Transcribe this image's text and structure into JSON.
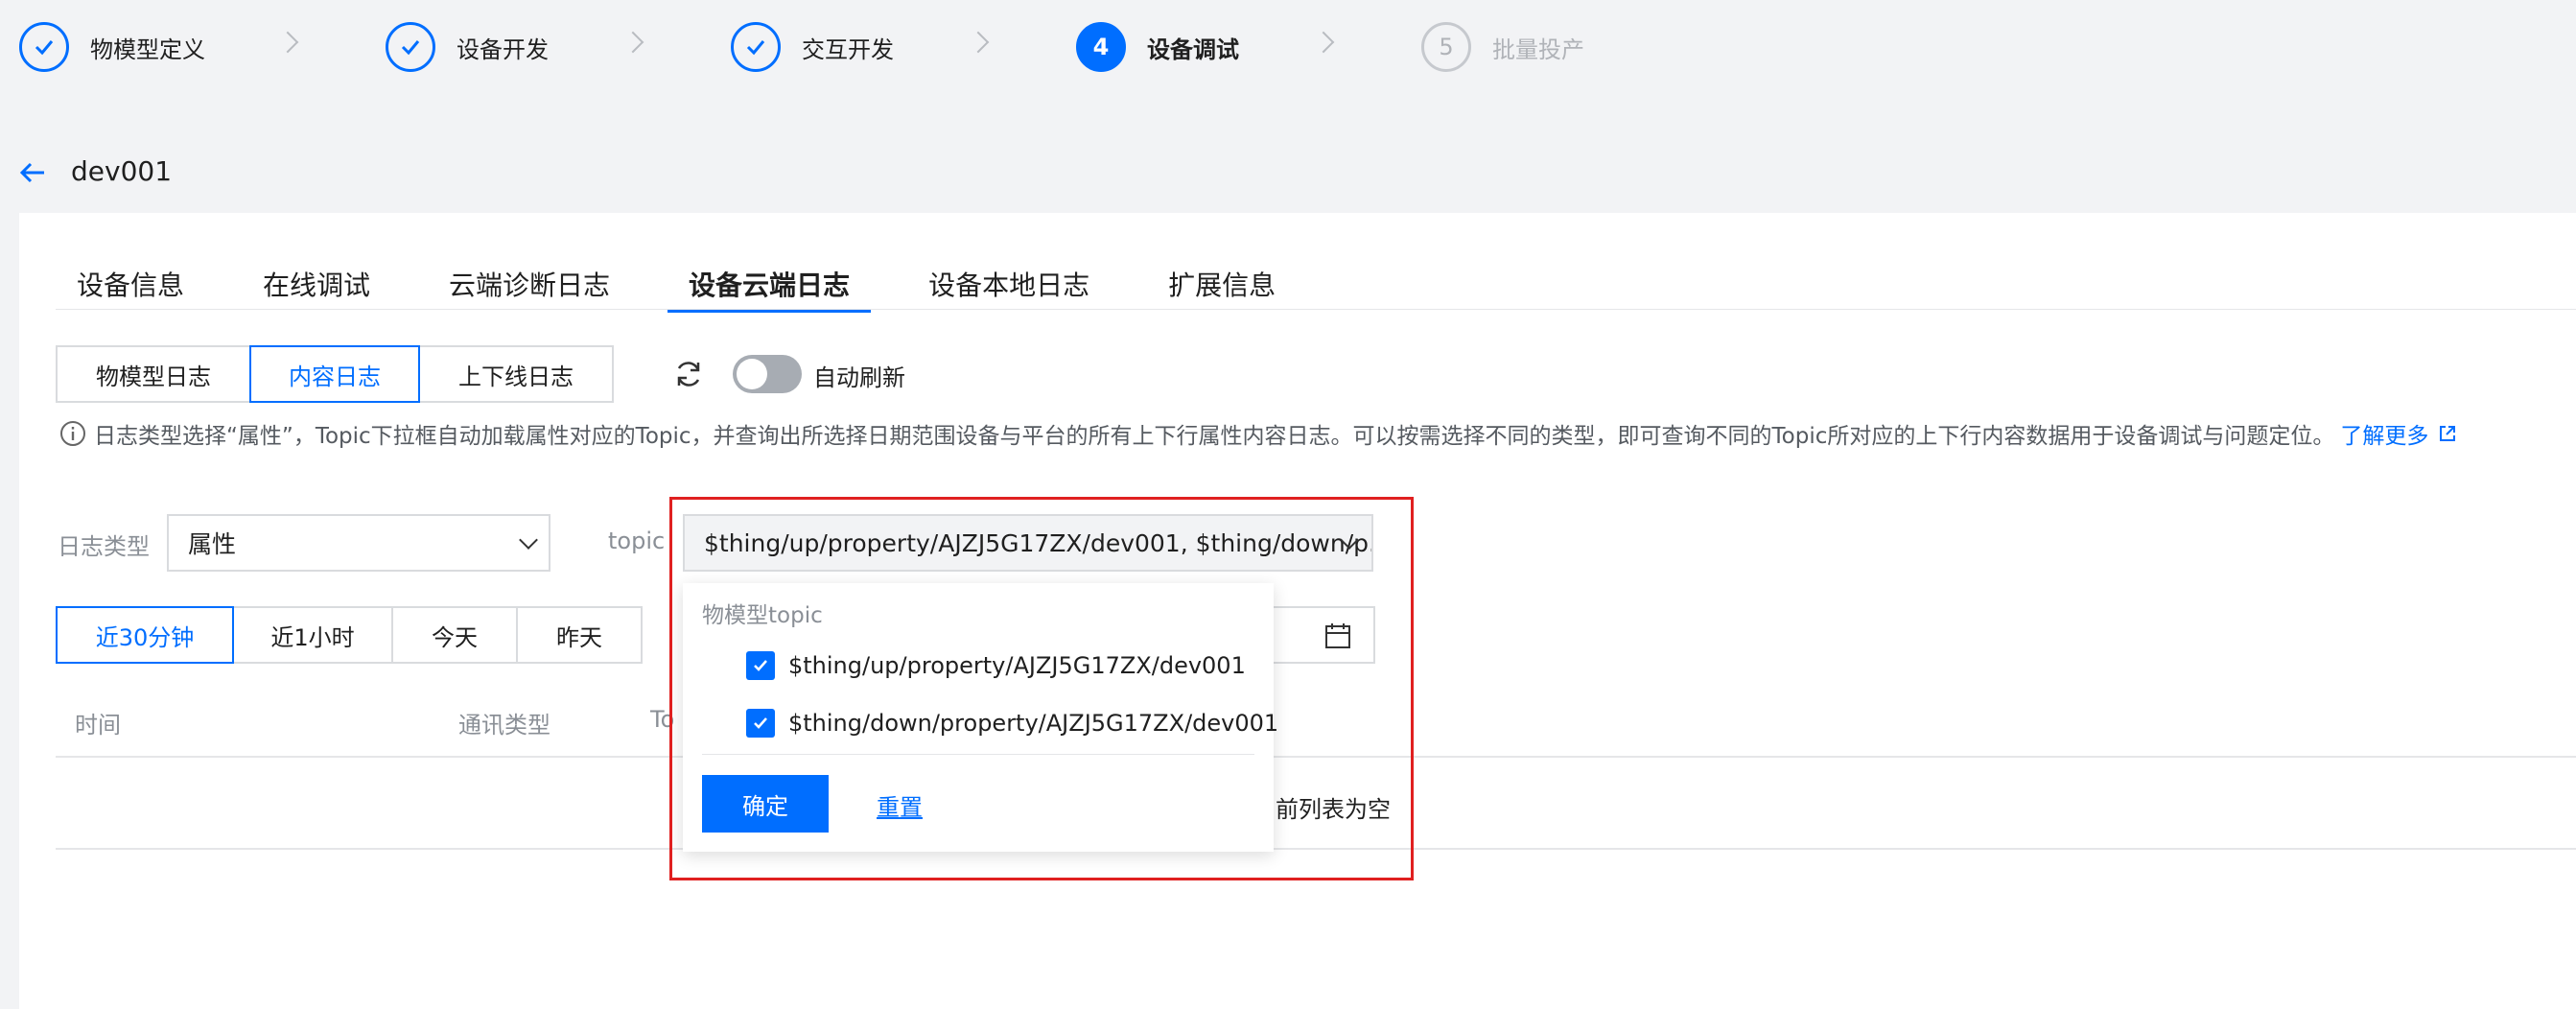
{
  "steps": [
    {
      "label": "物模型定义",
      "state": "done"
    },
    {
      "label": "设备开发",
      "state": "done"
    },
    {
      "label": "交互开发",
      "state": "done"
    },
    {
      "label": "设备调试",
      "state": "active",
      "number": "4"
    },
    {
      "label": "批量投产",
      "state": "pending",
      "number": "5"
    }
  ],
  "header": {
    "device_name": "dev001"
  },
  "tabs": [
    "设备信息",
    "在线调试",
    "云端诊断日志",
    "设备云端日志",
    "设备本地日志",
    "扩展信息"
  ],
  "log_types": [
    "物模型日志",
    "内容日志",
    "上下线日志"
  ],
  "auto_refresh_label": "自动刷新",
  "info": {
    "text": "日志类型选择“属性”，Topic下拉框自动加载属性对应的Topic，并查询出所选择日期范围设备与平台的所有上下行属性内容日志。可以按需选择不同的类型，即可查询不同的Topic所对应的上下行内容数据用于设备调试与问题定位。",
    "link": "了解更多"
  },
  "filters": {
    "log_type_label": "日志类型",
    "log_type_value": "属性",
    "topic_label": "topic",
    "topic_value": "$thing/up/property/AJZJ5G17ZX/dev001, $thing/down/p..."
  },
  "time_ranges": [
    "近30分钟",
    "近1小时",
    "今天",
    "昨天"
  ],
  "table": {
    "headers": [
      "时间",
      "通讯类型",
      "To"
    ],
    "empty_text": "前列表为空"
  },
  "dropdown": {
    "group_label": "物模型topic",
    "options": [
      "$thing/up/property/AJZJ5G17ZX/dev001",
      "$thing/down/property/AJZJ5G17ZX/dev001"
    ],
    "confirm": "确定",
    "reset": "重置"
  },
  "colors": {
    "accent": "#006eff",
    "highlight": "#e02020"
  }
}
